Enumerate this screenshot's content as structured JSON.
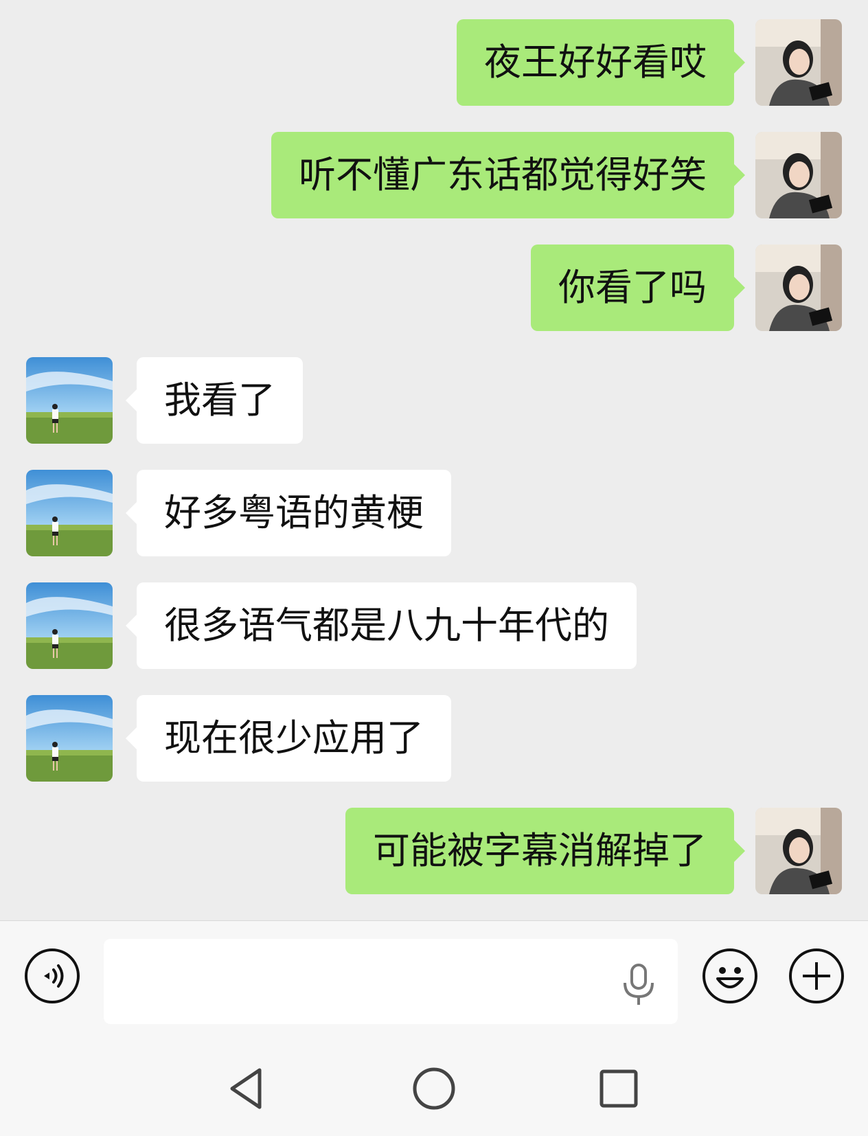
{
  "conversation": {
    "messages": [
      {
        "from": "me",
        "avatar": "woman-avatar",
        "text": "夜王好好看哎"
      },
      {
        "from": "me",
        "avatar": "woman-avatar",
        "text": "听不懂广东话都觉得好笑"
      },
      {
        "from": "me",
        "avatar": "woman-avatar",
        "text": "你看了吗"
      },
      {
        "from": "other",
        "avatar": "grassland-avatar",
        "text": "我看了"
      },
      {
        "from": "other",
        "avatar": "grassland-avatar",
        "text": "好多粤语的黄梗"
      },
      {
        "from": "other",
        "avatar": "grassland-avatar",
        "text": "很多语气都是八九十年代的"
      },
      {
        "from": "other",
        "avatar": "grassland-avatar",
        "text": "现在很少应用了"
      },
      {
        "from": "me",
        "avatar": "woman-avatar",
        "text": "可能被字幕消解掉了"
      }
    ]
  },
  "colors": {
    "background": "#ededed",
    "outgoing_bubble": "#a9ea7a",
    "incoming_bubble": "#ffffff",
    "bar_background": "#f7f7f7"
  },
  "input_bar": {
    "text_value": "",
    "icons": [
      "voice-mode-icon",
      "microphone-icon",
      "emoji-icon",
      "plus-icon"
    ]
  },
  "nav_bar": {
    "icons": [
      "back-triangle-icon",
      "home-circle-icon",
      "recents-square-icon"
    ]
  }
}
